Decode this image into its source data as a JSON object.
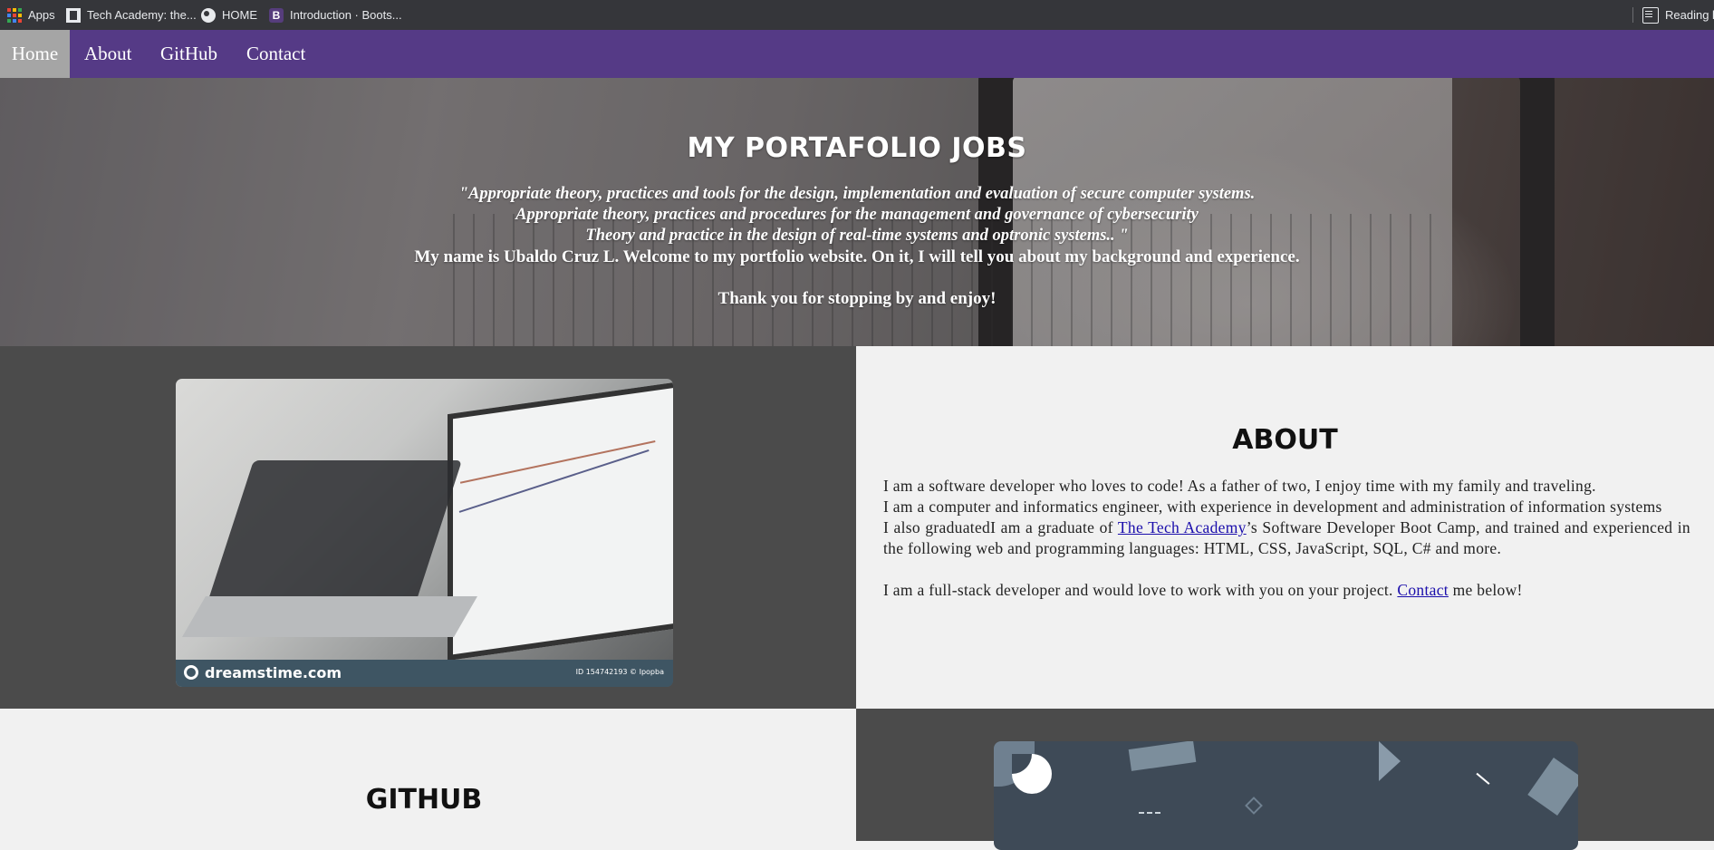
{
  "browser": {
    "bookmarks": [
      {
        "label": "Apps",
        "icon": "apps-grid-icon"
      },
      {
        "label": "Tech Academy: the...",
        "icon": "tech-academy-favicon"
      },
      {
        "label": "HOME",
        "icon": "globe-icon"
      },
      {
        "label": "Introduction · Boots...",
        "icon": "bootstrap-favicon",
        "icon_text": "B"
      }
    ],
    "reading_list": {
      "label": "Reading list",
      "icon": "reading-list-icon"
    }
  },
  "nav": {
    "items": [
      {
        "label": "Home",
        "active": true
      },
      {
        "label": "About",
        "active": false
      },
      {
        "label": "GitHub",
        "active": false
      },
      {
        "label": "Contact",
        "active": false
      }
    ]
  },
  "hero": {
    "title": "MY PORTAFOLIO JOBS",
    "quote_lines": [
      "\"Appropriate theory, practices and tools for the design, implementation and evaluation of secure computer systems.",
      "Appropriate theory, practices and procedures for the management and governance of cybersecurity",
      "Theory and practice in the design of real-time systems and optronic systems.. \""
    ],
    "intro": "My name is Ubaldo Cruz L. Welcome to my portfolio website. On it, I will tell you about my background and experience.",
    "thanks": "Thank you for stopping by and enjoy!"
  },
  "about": {
    "title": "ABOUT",
    "p1": "I am a software developer who loves to code! As a father of two, I enjoy time with my family and traveling.",
    "p2": "I am a computer and informatics engineer, with experience in development and administration of information systems",
    "p3_before": "I also graduatedI am a graduate of ",
    "p3_link": "The Tech Academy",
    "p3_after": "’s Software Developer Boot Camp, and trained and experienced in the following web and programming languages: HTML, CSS, JavaScript, SQL, C# and more.",
    "p4_before": "I am a full-stack developer and would love to work with you on your project. ",
    "p4_link": "Contact",
    "p4_after": " me below!",
    "image": {
      "brand": "dreamstime.com",
      "id_text": "ID 154742193 © Ipopba"
    }
  },
  "github": {
    "title": "GITHUB"
  },
  "colors": {
    "navbar": "#553a86",
    "nav_active": "#a5a5a5",
    "dark_panel": "#4b4b4b",
    "light_panel": "#f1f1f1",
    "link": "#1a0dab"
  }
}
